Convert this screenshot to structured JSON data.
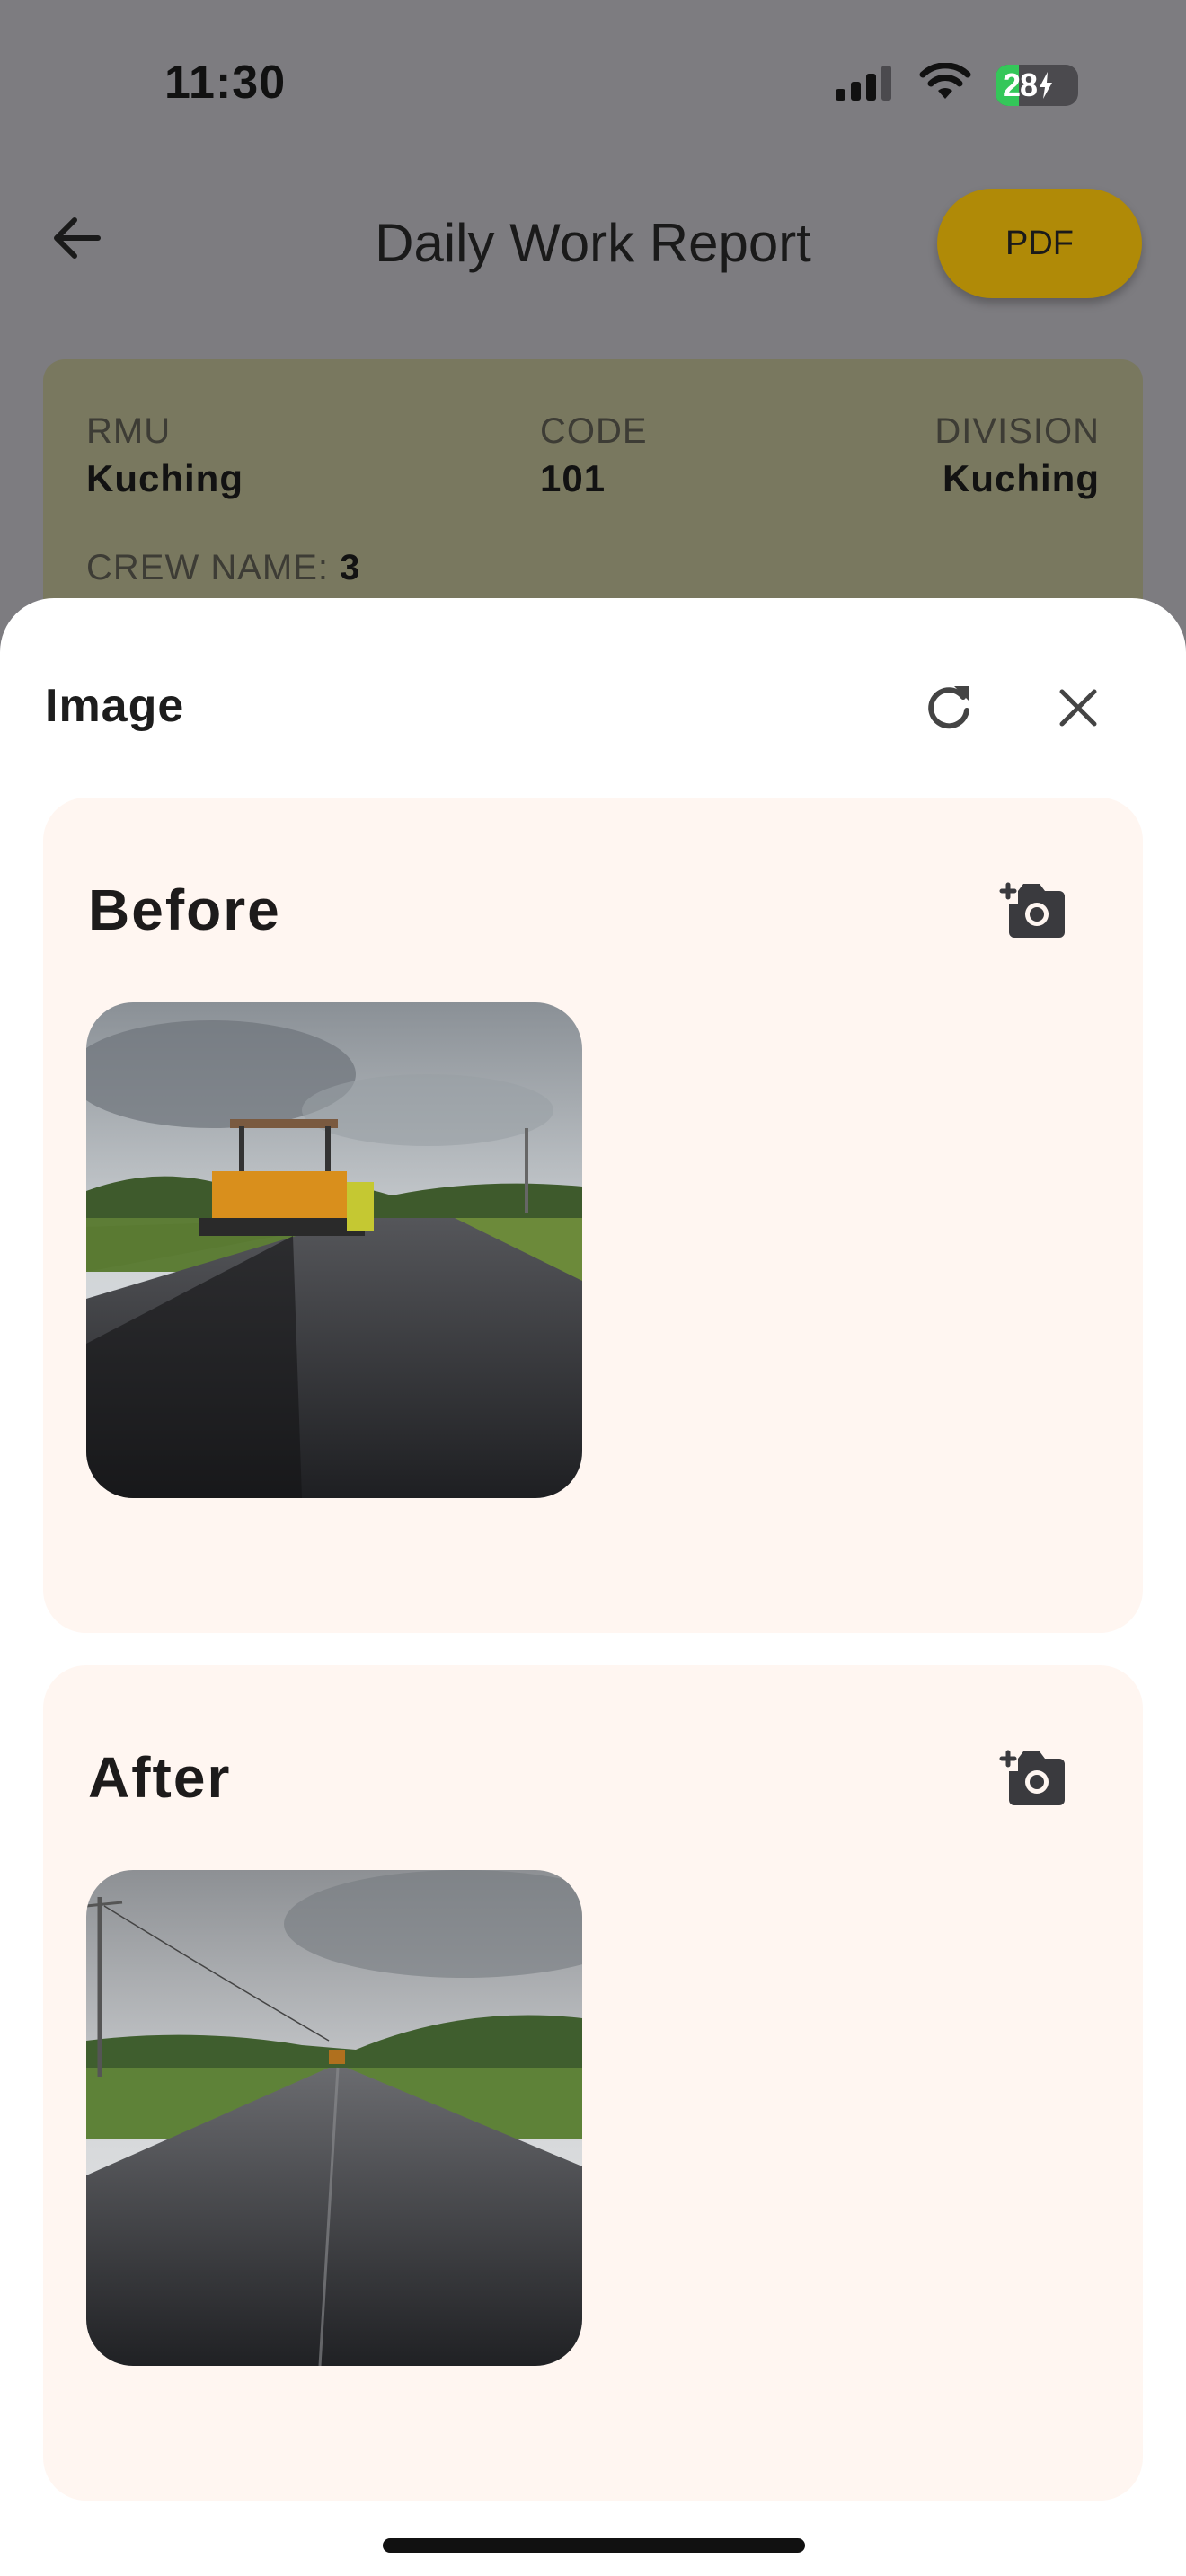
{
  "status_bar": {
    "time": "11:30",
    "battery": "28",
    "battery_level": 0.28,
    "icons": [
      "cellular-signal-icon",
      "wifi-icon",
      "battery-charging-icon"
    ]
  },
  "app_bar": {
    "back_icon": "arrow-left-icon",
    "title": "Daily Work Report",
    "pdf_label": "PDF"
  },
  "info": {
    "rmu_label": "RMU",
    "rmu_value": "Kuching",
    "code_label": "CODE",
    "code_value": "101",
    "division_label": "DIVISION",
    "division_value": "Kuching",
    "crew_label": "CREW NAME:",
    "crew_value": "3"
  },
  "sheet": {
    "title": "Image",
    "refresh_icon": "refresh-icon",
    "close_icon": "close-icon",
    "sections": [
      {
        "title": "Before",
        "action_icon": "add-photo-icon",
        "photo": "road-paving-photo"
      },
      {
        "title": "After",
        "action_icon": "add-photo-icon",
        "photo": "paved-road-photo"
      }
    ]
  },
  "colors": {
    "accent": "#b08a07",
    "card_bg": "#fff6f1",
    "overlay": "#7d7c80",
    "battery_green": "#34c759"
  }
}
